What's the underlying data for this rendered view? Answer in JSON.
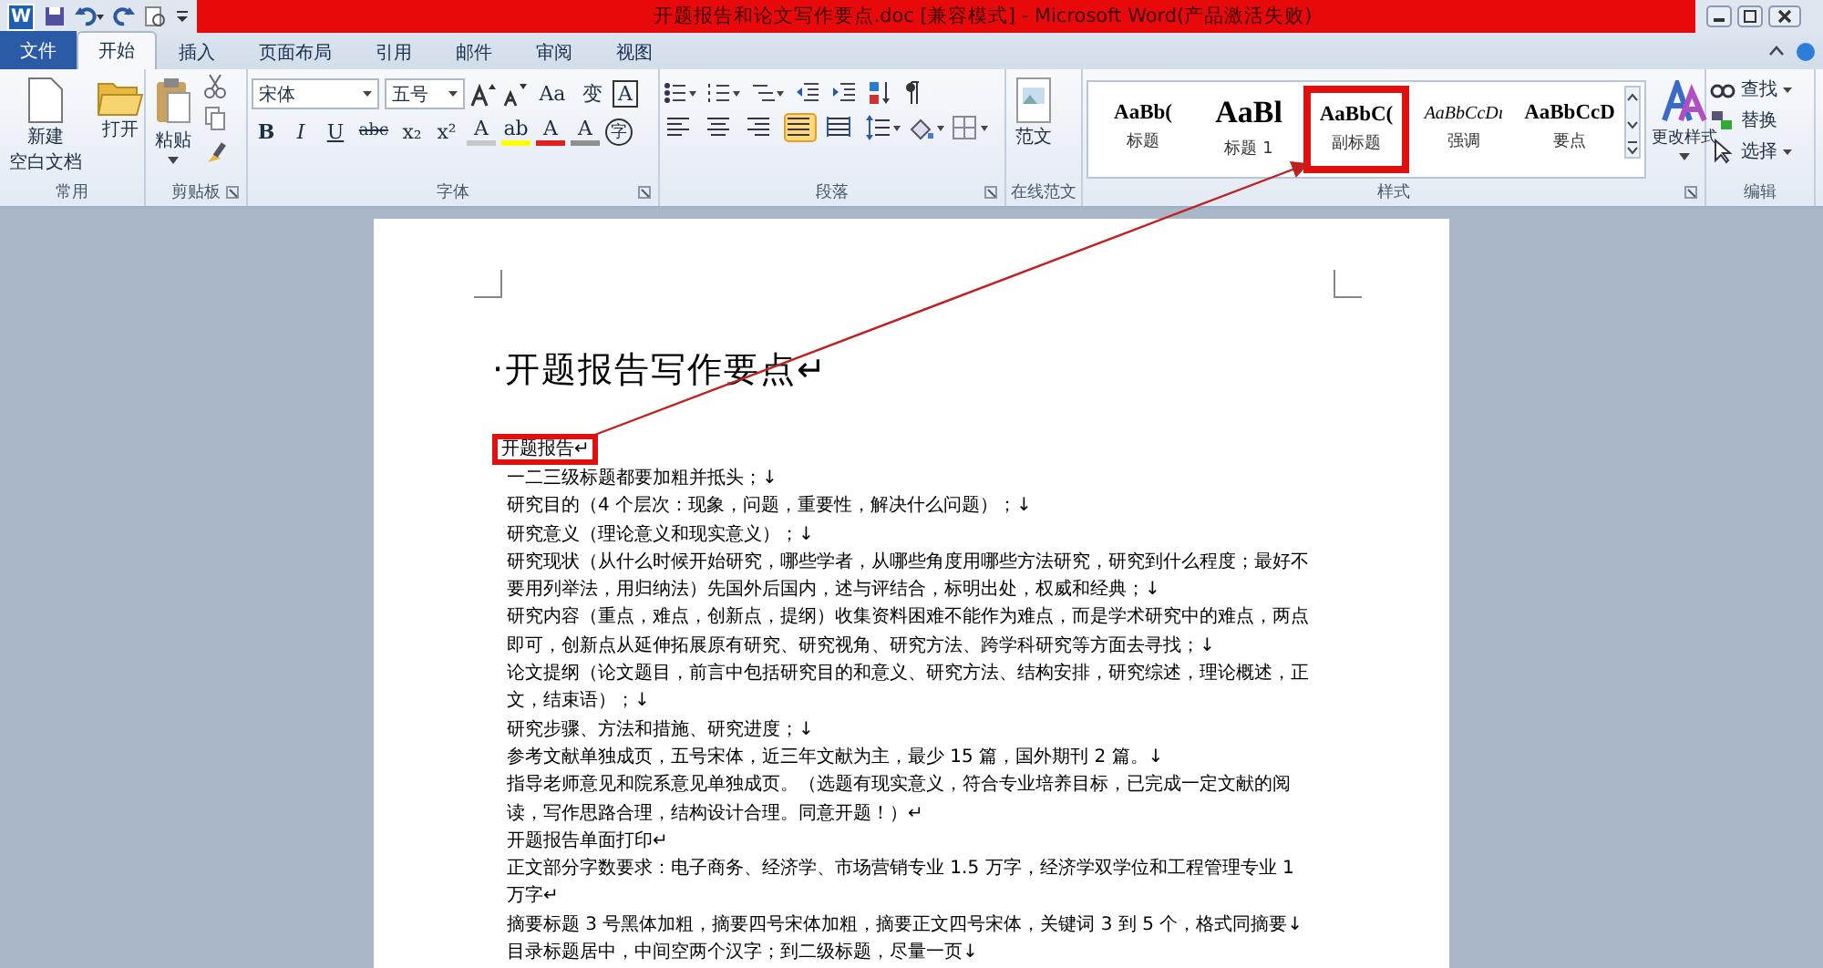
{
  "quick_access": {
    "app_icon": "W"
  },
  "window": {
    "title": "开题报告和论文写作要点.doc [兼容模式] - Microsoft Word(产品激活失败)"
  },
  "tabs": [
    {
      "label": "文件",
      "selected": false,
      "kind": "file"
    },
    {
      "label": "开始",
      "selected": true,
      "kind": "tab"
    },
    {
      "label": "插入",
      "selected": false,
      "kind": "tab"
    },
    {
      "label": "页面布局",
      "selected": false,
      "kind": "tab"
    },
    {
      "label": "引用",
      "selected": false,
      "kind": "tab"
    },
    {
      "label": "邮件",
      "selected": false,
      "kind": "tab"
    },
    {
      "label": "审阅",
      "selected": false,
      "kind": "tab"
    },
    {
      "label": "视图",
      "selected": false,
      "kind": "tab"
    }
  ],
  "ribbon": {
    "common": {
      "label": "常用",
      "new_doc": [
        "新建",
        "空白文档"
      ],
      "open": "打开"
    },
    "clipboard": {
      "label": "剪贴板",
      "paste": "粘贴"
    },
    "font": {
      "label": "字体",
      "font_name": "宋体",
      "font_size": "五号",
      "case_button": "Aa",
      "phonetic": "变",
      "border_char": "A",
      "format_buttons": [
        {
          "glyph": "B",
          "kind": "bold"
        },
        {
          "glyph": "I",
          "kind": "italic"
        },
        {
          "glyph": "U",
          "kind": "underline"
        },
        {
          "glyph": "abc",
          "kind": "strike"
        },
        {
          "glyph": "x₂",
          "kind": "plain"
        },
        {
          "glyph": "x²",
          "kind": "plain"
        }
      ],
      "color_buttons": [
        {
          "glyph": "A",
          "color": "#c8c8c8"
        },
        {
          "glyph": "ab",
          "color": "#ffff00"
        },
        {
          "glyph": "A",
          "color": "#e02020"
        },
        {
          "glyph": "A",
          "color": "#909090"
        }
      ],
      "enclose": "字"
    },
    "paragraph": {
      "label": "段落",
      "alignment": [
        {
          "selected": false
        },
        {
          "selected": false
        },
        {
          "selected": false
        },
        {
          "selected": true
        },
        {
          "selected": false
        }
      ]
    },
    "online": {
      "label": "在线范文",
      "button": "范文"
    },
    "styles": {
      "label": "样式",
      "items": [
        {
          "preview": "AaBb(",
          "label": "标题",
          "highlighted": false,
          "kind": "bold"
        },
        {
          "preview": "AaBl",
          "label": "标题 1",
          "highlighted": false,
          "kind": "large"
        },
        {
          "preview": "AaBbC(",
          "label": "副标题",
          "highlighted": true,
          "kind": "bold"
        },
        {
          "preview": "AaBbCcDı",
          "label": "强调",
          "highlighted": false,
          "kind": "italic"
        },
        {
          "preview": "AaBbCcD",
          "label": "要点",
          "highlighted": false,
          "kind": "bold"
        }
      ],
      "change": "更改样式"
    },
    "editing": {
      "label": "编辑",
      "items": [
        "查找",
        "替换",
        "选择"
      ]
    }
  },
  "document": {
    "heading": "·开题报告写作要点↵",
    "paragraphs": [
      {
        "text": "开题报告↵",
        "highlighted": true
      },
      {
        "text": "一二三级标题都要加粗并抵头；↓",
        "highlighted": false
      },
      {
        "text": "研究目的（4 个层次：现象，问题，重要性，解决什么问题）；↓",
        "highlighted": false
      },
      {
        "text": "研究意义（理论意义和现实意义）；↓",
        "highlighted": false
      },
      {
        "text": "研究现状（从什么时候开始研究，哪些学者，从哪些角度用哪些方法研究，研究到什么程度；最好不要用列举法，用归纳法）先国外后国内，述与评结合，标明出处，权威和经典；↓",
        "highlighted": false
      },
      {
        "text": "研究内容（重点，难点，创新点，提纲）收集资料困难不能作为难点，而是学术研究中的难点，两点即可，创新点从延伸拓展原有研究、研究视角、研究方法、跨学科研究等方面去寻找；↓",
        "highlighted": false
      },
      {
        "text": "论文提纲（论文题目，前言中包括研究目的和意义、研究方法、结构安排，研究综述，理论概述，正文，结束语）；↓",
        "highlighted": false
      },
      {
        "text": "研究步骤、方法和措施、研究进度；↓",
        "highlighted": false
      },
      {
        "text": "参考文献单独成页，五号宋体，近三年文献为主，最少 15 篇，国外期刊 2 篇。↓",
        "highlighted": false
      },
      {
        "text": "指导老师意见和院系意见单独成页。（选题有现实意义，符合专业培养目标，已完成一定文献的阅读，写作思路合理，结构设计合理。同意开题！）↵",
        "highlighted": false
      },
      {
        "text": "开题报告单面打印↵",
        "highlighted": false
      },
      {
        "text": "正文部分字数要求：电子商务、经济学、市场营销专业 1.5 万字，经济学双学位和工程管理专业 1 万字↵",
        "highlighted": false
      },
      {
        "text": "摘要标题 3 号黑体加粗，摘要四号宋体加粗，摘要正文四号宋体，关键词 3 到 5 个，格式同摘要↓",
        "highlighted": false
      },
      {
        "text": "目录标题居中，中间空两个汉字；到二级标题，尽量一页↓",
        "highlighted": false
      }
    ]
  }
}
